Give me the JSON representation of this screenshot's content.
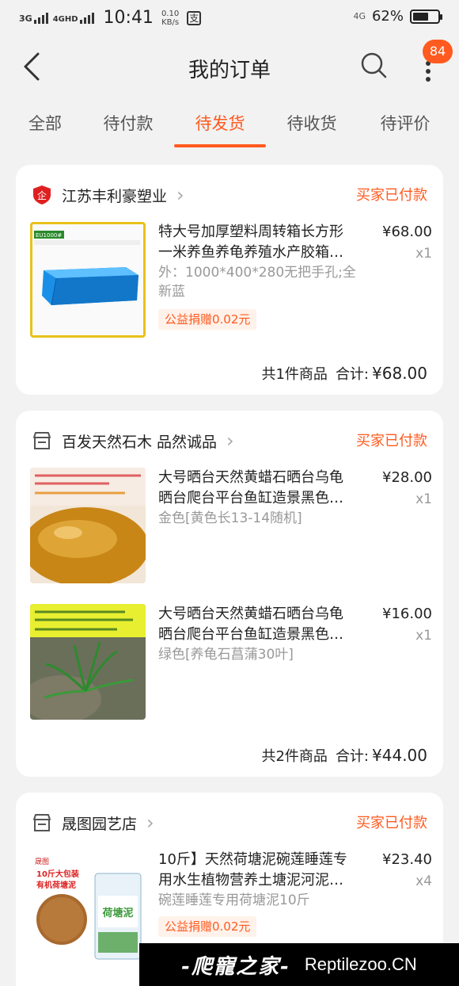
{
  "status_bar": {
    "signal1": "3G",
    "signal2": "4GHD",
    "time": "10:41",
    "speed_value": "0.10",
    "speed_unit": "KB/s",
    "pay_icon_text": "支",
    "net": "4G",
    "battery": "62%",
    "battery_level": 0.62
  },
  "header": {
    "title": "我的订单",
    "badge_count": "84"
  },
  "tabs": [
    {
      "label": "全部"
    },
    {
      "label": "待付款"
    },
    {
      "label": "待发货",
      "active": true
    },
    {
      "label": "待收货"
    },
    {
      "label": "待评价"
    }
  ],
  "orders": [
    {
      "shop": "江苏丰利豪塑业",
      "status": "买家已付款",
      "items": [
        {
          "title": "特大号加厚塑料周转箱长方形一米养鱼养龟养殖水产胶箱…",
          "title_line1": "特大号加厚塑料周转箱长方形",
          "title_line2": "一米养鱼养龟养殖水产胶箱…",
          "spec": "外：1000*400*280无把手孔;全新蓝",
          "price": "¥68.00",
          "qty": "x1",
          "tag": "公益捐赠0.02元",
          "thumb_label": "EU1000#"
        }
      ],
      "summary_count": "共1件商品",
      "summary_label": "合计:",
      "summary_total": "¥68.00"
    },
    {
      "shop": "百发天然石木 品然诚品",
      "status": "买家已付款",
      "items": [
        {
          "title_line1": "大号晒台天然黄蜡石晒台乌龟",
          "title_line2": "晒台爬台平台鱼缸造景黑色…",
          "spec": "金色[黄色长13-14随机]",
          "price": "¥28.00",
          "qty": "x1"
        },
        {
          "title_line1": "大号晒台天然黄蜡石晒台乌龟",
          "title_line2": "晒台爬台平台鱼缸造景黑色…",
          "spec": "绿色[养龟石菖蒲30叶]",
          "price": "¥16.00",
          "qty": "x1"
        }
      ],
      "summary_count": "共2件商品",
      "summary_label": "合计:",
      "summary_total": "¥44.00"
    },
    {
      "shop": "晟图园艺店",
      "status": "买家已付款",
      "items": [
        {
          "title_line1": "10斤】天然荷塘泥碗莲睡莲专",
          "title_line2": "用水生植物营养土塘泥河泥…",
          "spec": "碗莲睡莲专用荷塘泥10斤",
          "price": "¥23.40",
          "qty": "x4",
          "tag": "公益捐赠0.02元",
          "thumb_text1": "10斤大包装",
          "thumb_text2": "有机荷塘泥",
          "thumb_bag": "荷塘泥"
        }
      ]
    }
  ],
  "watermark": {
    "left": "-爬寵之家-",
    "right": "Reptilezoo.CN"
  },
  "colors": {
    "accent": "#ff5a1f",
    "background": "#f2f2f2"
  }
}
